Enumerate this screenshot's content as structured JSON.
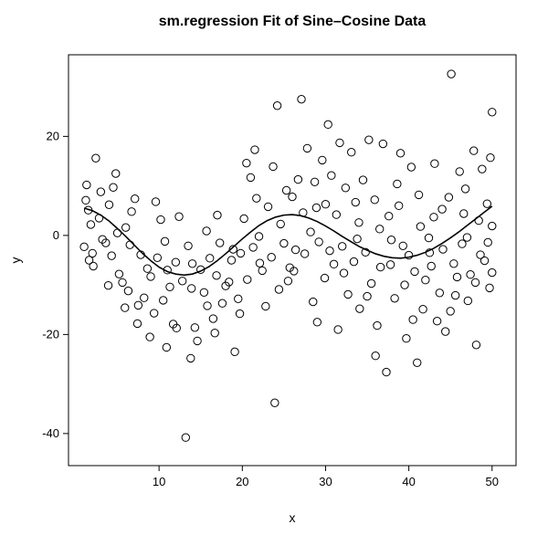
{
  "chart_data": {
    "type": "scatter",
    "title": "sm.regression Fit of Sine–Cosine Data",
    "xlabel": "x",
    "ylabel": "y",
    "xlim": [
      0,
      52
    ],
    "ylim": [
      -45,
      35
    ],
    "xticks": [
      10,
      20,
      30,
      40,
      50
    ],
    "yticks": [
      -40,
      -20,
      0,
      20
    ],
    "points": [
      {
        "x": 1.0,
        "y": -2.3
      },
      {
        "x": 1.2,
        "y": 7.1
      },
      {
        "x": 1.5,
        "y": 5.1
      },
      {
        "x": 1.8,
        "y": 2.2
      },
      {
        "x": 2.1,
        "y": -6.2
      },
      {
        "x": 2.4,
        "y": 15.6
      },
      {
        "x": 2.8,
        "y": 3.5
      },
      {
        "x": 3.2,
        "y": -0.8
      },
      {
        "x": 3.6,
        "y": -1.5
      },
      {
        "x": 4.0,
        "y": 6.2
      },
      {
        "x": 4.3,
        "y": -4.1
      },
      {
        "x": 4.8,
        "y": 12.5
      },
      {
        "x": 5.2,
        "y": -7.8
      },
      {
        "x": 5.6,
        "y": -9.5
      },
      {
        "x": 6.0,
        "y": 1.6
      },
      {
        "x": 6.3,
        "y": -11.2
      },
      {
        "x": 6.7,
        "y": 4.8
      },
      {
        "x": 7.1,
        "y": 7.4
      },
      {
        "x": 7.5,
        "y": -14.1
      },
      {
        "x": 7.8,
        "y": -3.9
      },
      {
        "x": 8.2,
        "y": -12.6
      },
      {
        "x": 8.6,
        "y": -6.7
      },
      {
        "x": 9.0,
        "y": -8.3
      },
      {
        "x": 9.4,
        "y": -15.7
      },
      {
        "x": 9.8,
        "y": -4.5
      },
      {
        "x": 10.2,
        "y": 3.2
      },
      {
        "x": 10.5,
        "y": -13.1
      },
      {
        "x": 10.9,
        "y": -22.6
      },
      {
        "x": 11.3,
        "y": -10.4
      },
      {
        "x": 11.7,
        "y": -17.9
      },
      {
        "x": 12.0,
        "y": -5.4
      },
      {
        "x": 12.4,
        "y": 3.8
      },
      {
        "x": 12.8,
        "y": -9.2
      },
      {
        "x": 13.2,
        "y": -40.8
      },
      {
        "x": 13.5,
        "y": -2.1
      },
      {
        "x": 13.9,
        "y": -10.7
      },
      {
        "x": 14.3,
        "y": -18.6
      },
      {
        "x": 14.6,
        "y": -21.3
      },
      {
        "x": 15.0,
        "y": -6.9
      },
      {
        "x": 15.4,
        "y": -11.5
      },
      {
        "x": 15.8,
        "y": -14.2
      },
      {
        "x": 16.1,
        "y": -4.6
      },
      {
        "x": 16.5,
        "y": -16.8
      },
      {
        "x": 16.9,
        "y": -8.1
      },
      {
        "x": 17.3,
        "y": -1.5
      },
      {
        "x": 17.6,
        "y": -13.7
      },
      {
        "x": 18.0,
        "y": -10.2
      },
      {
        "x": 18.4,
        "y": -9.4
      },
      {
        "x": 18.7,
        "y": -5.0
      },
      {
        "x": 19.1,
        "y": -23.5
      },
      {
        "x": 19.5,
        "y": -12.8
      },
      {
        "x": 19.8,
        "y": -3.6
      },
      {
        "x": 20.2,
        "y": 3.4
      },
      {
        "x": 20.6,
        "y": -8.9
      },
      {
        "x": 21.0,
        "y": 11.7
      },
      {
        "x": 21.3,
        "y": -2.4
      },
      {
        "x": 21.7,
        "y": 7.5
      },
      {
        "x": 22.0,
        "y": -0.2
      },
      {
        "x": 22.4,
        "y": -7.1
      },
      {
        "x": 22.8,
        "y": -14.3
      },
      {
        "x": 23.1,
        "y": 5.8
      },
      {
        "x": 23.5,
        "y": -4.4
      },
      {
        "x": 23.9,
        "y": -33.8
      },
      {
        "x": 24.2,
        "y": 26.2
      },
      {
        "x": 24.6,
        "y": 2.3
      },
      {
        "x": 25.0,
        "y": -1.6
      },
      {
        "x": 25.3,
        "y": 9.1
      },
      {
        "x": 25.7,
        "y": -6.5
      },
      {
        "x": 26.0,
        "y": 7.8
      },
      {
        "x": 26.4,
        "y": -2.9
      },
      {
        "x": 26.7,
        "y": 11.3
      },
      {
        "x": 27.1,
        "y": 27.5
      },
      {
        "x": 27.5,
        "y": -3.7
      },
      {
        "x": 27.8,
        "y": 17.6
      },
      {
        "x": 28.2,
        "y": 0.7
      },
      {
        "x": 28.5,
        "y": -13.4
      },
      {
        "x": 28.9,
        "y": 5.6
      },
      {
        "x": 29.2,
        "y": -1.3
      },
      {
        "x": 29.6,
        "y": 15.2
      },
      {
        "x": 29.9,
        "y": -8.6
      },
      {
        "x": 30.3,
        "y": 22.4
      },
      {
        "x": 30.7,
        "y": 12.1
      },
      {
        "x": 31.0,
        "y": -5.8
      },
      {
        "x": 31.3,
        "y": 4.2
      },
      {
        "x": 31.7,
        "y": 18.7
      },
      {
        "x": 32.0,
        "y": -2.2
      },
      {
        "x": 32.4,
        "y": 9.6
      },
      {
        "x": 32.7,
        "y": -11.9
      },
      {
        "x": 33.1,
        "y": 16.8
      },
      {
        "x": 33.4,
        "y": -5.3
      },
      {
        "x": 33.8,
        "y": -0.7
      },
      {
        "x": 34.1,
        "y": -14.8
      },
      {
        "x": 34.5,
        "y": 11.2
      },
      {
        "x": 34.8,
        "y": -3.4
      },
      {
        "x": 35.2,
        "y": 19.3
      },
      {
        "x": 35.5,
        "y": -9.7
      },
      {
        "x": 35.9,
        "y": 7.2
      },
      {
        "x": 36.2,
        "y": -18.2
      },
      {
        "x": 36.6,
        "y": -6.4
      },
      {
        "x": 36.9,
        "y": 18.5
      },
      {
        "x": 37.3,
        "y": -27.6
      },
      {
        "x": 37.6,
        "y": 3.9
      },
      {
        "x": 37.9,
        "y": -0.9
      },
      {
        "x": 38.3,
        "y": -12.7
      },
      {
        "x": 38.6,
        "y": 10.4
      },
      {
        "x": 39.0,
        "y": 16.6
      },
      {
        "x": 39.3,
        "y": -2.1
      },
      {
        "x": 39.7,
        "y": -20.8
      },
      {
        "x": 40.0,
        "y": -4.0
      },
      {
        "x": 40.3,
        "y": 13.8
      },
      {
        "x": 40.7,
        "y": -7.3
      },
      {
        "x": 41.0,
        "y": -25.7
      },
      {
        "x": 41.4,
        "y": 1.8
      },
      {
        "x": 41.7,
        "y": -14.9
      },
      {
        "x": 42.0,
        "y": -9.0
      },
      {
        "x": 42.4,
        "y": -0.5
      },
      {
        "x": 42.7,
        "y": -6.2
      },
      {
        "x": 43.1,
        "y": 14.5
      },
      {
        "x": 43.4,
        "y": -17.3
      },
      {
        "x": 43.7,
        "y": -11.6
      },
      {
        "x": 44.1,
        "y": -2.8
      },
      {
        "x": 44.4,
        "y": -19.4
      },
      {
        "x": 44.8,
        "y": 7.7
      },
      {
        "x": 45.1,
        "y": 32.6
      },
      {
        "x": 45.4,
        "y": -5.7
      },
      {
        "x": 45.8,
        "y": -8.4
      },
      {
        "x": 46.1,
        "y": 12.9
      },
      {
        "x": 46.4,
        "y": -1.7
      },
      {
        "x": 46.8,
        "y": 9.4
      },
      {
        "x": 47.1,
        "y": -13.2
      },
      {
        "x": 47.4,
        "y": -7.9
      },
      {
        "x": 47.8,
        "y": 17.1
      },
      {
        "x": 48.1,
        "y": -22.1
      },
      {
        "x": 48.4,
        "y": 3.0
      },
      {
        "x": 48.8,
        "y": 13.4
      },
      {
        "x": 49.1,
        "y": -5.1
      },
      {
        "x": 49.4,
        "y": 6.4
      },
      {
        "x": 49.7,
        "y": -10.6
      },
      {
        "x": 50.0,
        "y": 24.9
      },
      {
        "x": 50.0,
        "y": 1.9
      },
      {
        "x": 1.3,
        "y": 10.2
      },
      {
        "x": 2.0,
        "y": -3.6
      },
      {
        "x": 3.0,
        "y": 8.8
      },
      {
        "x": 3.9,
        "y": -10.1
      },
      {
        "x": 5.0,
        "y": 0.5
      },
      {
        "x": 5.9,
        "y": -14.6
      },
      {
        "x": 7.4,
        "y": -17.8
      },
      {
        "x": 8.9,
        "y": -20.5
      },
      {
        "x": 10.7,
        "y": -1.2
      },
      {
        "x": 12.1,
        "y": -18.7
      },
      {
        "x": 13.8,
        "y": -24.8
      },
      {
        "x": 15.7,
        "y": 0.9
      },
      {
        "x": 17.0,
        "y": 4.1
      },
      {
        "x": 18.9,
        "y": -2.8
      },
      {
        "x": 20.5,
        "y": 14.6
      },
      {
        "x": 22.1,
        "y": -5.6
      },
      {
        "x": 23.7,
        "y": 13.9
      },
      {
        "x": 25.5,
        "y": -9.2
      },
      {
        "x": 27.3,
        "y": 4.6
      },
      {
        "x": 29.0,
        "y": -17.5
      },
      {
        "x": 30.5,
        "y": -3.1
      },
      {
        "x": 32.2,
        "y": -7.6
      },
      {
        "x": 33.6,
        "y": 6.7
      },
      {
        "x": 35.0,
        "y": -12.3
      },
      {
        "x": 36.5,
        "y": 1.3
      },
      {
        "x": 37.8,
        "y": -5.9
      },
      {
        "x": 39.5,
        "y": -10.0
      },
      {
        "x": 41.2,
        "y": 8.2
      },
      {
        "x": 42.5,
        "y": -3.5
      },
      {
        "x": 44.0,
        "y": 5.3
      },
      {
        "x": 45.6,
        "y": -12.1
      },
      {
        "x": 47.0,
        "y": -0.4
      },
      {
        "x": 48.6,
        "y": -3.9
      },
      {
        "x": 49.8,
        "y": 15.7
      },
      {
        "x": 1.6,
        "y": -5.0
      },
      {
        "x": 4.5,
        "y": 9.7
      },
      {
        "x": 6.5,
        "y": -1.9
      },
      {
        "x": 9.6,
        "y": 6.8
      },
      {
        "x": 11.0,
        "y": -7.0
      },
      {
        "x": 14.0,
        "y": -5.7
      },
      {
        "x": 16.7,
        "y": -19.7
      },
      {
        "x": 19.7,
        "y": -15.8
      },
      {
        "x": 21.5,
        "y": 17.3
      },
      {
        "x": 24.4,
        "y": -10.9
      },
      {
        "x": 26.2,
        "y": -7.2
      },
      {
        "x": 28.7,
        "y": 10.8
      },
      {
        "x": 30.0,
        "y": 6.3
      },
      {
        "x": 31.5,
        "y": -19.0
      },
      {
        "x": 34.0,
        "y": 2.6
      },
      {
        "x": 36.0,
        "y": -24.3
      },
      {
        "x": 38.8,
        "y": 6.0
      },
      {
        "x": 40.5,
        "y": -17.0
      },
      {
        "x": 43.0,
        "y": 3.7
      },
      {
        "x": 45.0,
        "y": -15.3
      },
      {
        "x": 46.6,
        "y": 4.4
      },
      {
        "x": 48.0,
        "y": -9.5
      },
      {
        "x": 49.5,
        "y": -1.4
      },
      {
        "x": 50.0,
        "y": -7.5
      }
    ],
    "fit": [
      {
        "x": 1.0,
        "y": 5.5
      },
      {
        "x": 2.0,
        "y": 5.0
      },
      {
        "x": 3.0,
        "y": 4.1
      },
      {
        "x": 4.0,
        "y": 2.9
      },
      {
        "x": 5.0,
        "y": 1.4
      },
      {
        "x": 6.0,
        "y": -0.2
      },
      {
        "x": 7.0,
        "y": -1.9
      },
      {
        "x": 8.0,
        "y": -3.6
      },
      {
        "x": 9.0,
        "y": -5.1
      },
      {
        "x": 10.0,
        "y": -6.4
      },
      {
        "x": 11.0,
        "y": -7.3
      },
      {
        "x": 12.0,
        "y": -7.8
      },
      {
        "x": 13.0,
        "y": -8.0
      },
      {
        "x": 14.0,
        "y": -7.8
      },
      {
        "x": 15.0,
        "y": -7.2
      },
      {
        "x": 16.0,
        "y": -6.3
      },
      {
        "x": 17.0,
        "y": -5.1
      },
      {
        "x": 18.0,
        "y": -3.7
      },
      {
        "x": 19.0,
        "y": -2.2
      },
      {
        "x": 20.0,
        "y": -0.7
      },
      {
        "x": 21.0,
        "y": 0.7
      },
      {
        "x": 22.0,
        "y": 2.0
      },
      {
        "x": 23.0,
        "y": 3.0
      },
      {
        "x": 24.0,
        "y": 3.7
      },
      {
        "x": 25.0,
        "y": 4.1
      },
      {
        "x": 26.0,
        "y": 4.2
      },
      {
        "x": 27.0,
        "y": 4.0
      },
      {
        "x": 28.0,
        "y": 3.5
      },
      {
        "x": 29.0,
        "y": 2.8
      },
      {
        "x": 30.0,
        "y": 1.9
      },
      {
        "x": 31.0,
        "y": 0.9
      },
      {
        "x": 32.0,
        "y": -0.2
      },
      {
        "x": 33.0,
        "y": -1.2
      },
      {
        "x": 34.0,
        "y": -2.2
      },
      {
        "x": 35.0,
        "y": -3.0
      },
      {
        "x": 36.0,
        "y": -3.7
      },
      {
        "x": 37.0,
        "y": -4.2
      },
      {
        "x": 38.0,
        "y": -4.5
      },
      {
        "x": 39.0,
        "y": -4.6
      },
      {
        "x": 40.0,
        "y": -4.4
      },
      {
        "x": 41.0,
        "y": -4.0
      },
      {
        "x": 42.0,
        "y": -3.4
      },
      {
        "x": 43.0,
        "y": -2.6
      },
      {
        "x": 44.0,
        "y": -1.6
      },
      {
        "x": 45.0,
        "y": -0.5
      },
      {
        "x": 46.0,
        "y": 0.7
      },
      {
        "x": 47.0,
        "y": 2.0
      },
      {
        "x": 48.0,
        "y": 3.3
      },
      {
        "x": 49.0,
        "y": 4.6
      },
      {
        "x": 50.0,
        "y": 5.9
      }
    ]
  }
}
